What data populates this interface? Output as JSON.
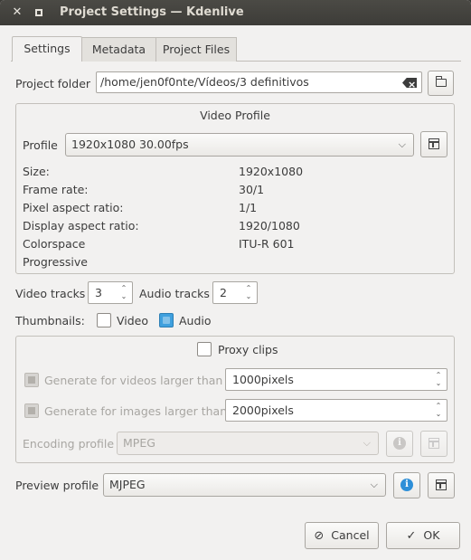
{
  "window": {
    "title": "Project Settings — Kdenlive"
  },
  "tabs": [
    {
      "label": "Settings",
      "active": true
    },
    {
      "label": "Metadata",
      "active": false
    },
    {
      "label": "Project Files",
      "active": false
    }
  ],
  "project_folder": {
    "label": "Project folder",
    "value": "/home/jen0f0nte/Vídeos/3 definitivos"
  },
  "video_profile": {
    "group_title": "Video Profile",
    "profile_label": "Profile",
    "profile_value": "1920x1080 30.00fps",
    "props": [
      {
        "key": "Size:",
        "value": "1920x1080"
      },
      {
        "key": "Frame rate:",
        "value": "30/1"
      },
      {
        "key": "Pixel aspect ratio:",
        "value": "1/1"
      },
      {
        "key": "Display aspect ratio:",
        "value": "1920/1080"
      },
      {
        "key": "Colorspace",
        "value": "ITU-R 601"
      },
      {
        "key": "Progressive",
        "value": ""
      }
    ]
  },
  "tracks": {
    "video_label": "Video tracks",
    "video_value": "3",
    "audio_label": "Audio tracks",
    "audio_value": "2"
  },
  "thumbnails": {
    "label": "Thumbnails:",
    "video_label": "Video",
    "video_checked": false,
    "audio_label": "Audio",
    "audio_checked": true
  },
  "proxy": {
    "label": "Proxy clips",
    "checked": false,
    "videos_label": "Generate for videos larger than",
    "videos_value": "1000pixels",
    "images_label": "Generate for images larger than",
    "images_value": "2000pixels",
    "encoding_label": "Encoding profile",
    "encoding_value": "MPEG"
  },
  "preview": {
    "label": "Preview profile",
    "value": "MJPEG"
  },
  "buttons": {
    "cancel": "Cancel",
    "ok": "OK"
  },
  "colors": {
    "accent": "#3fa0de",
    "titlebar": "#3d3c38",
    "window_bg": "#f2f1f0"
  }
}
